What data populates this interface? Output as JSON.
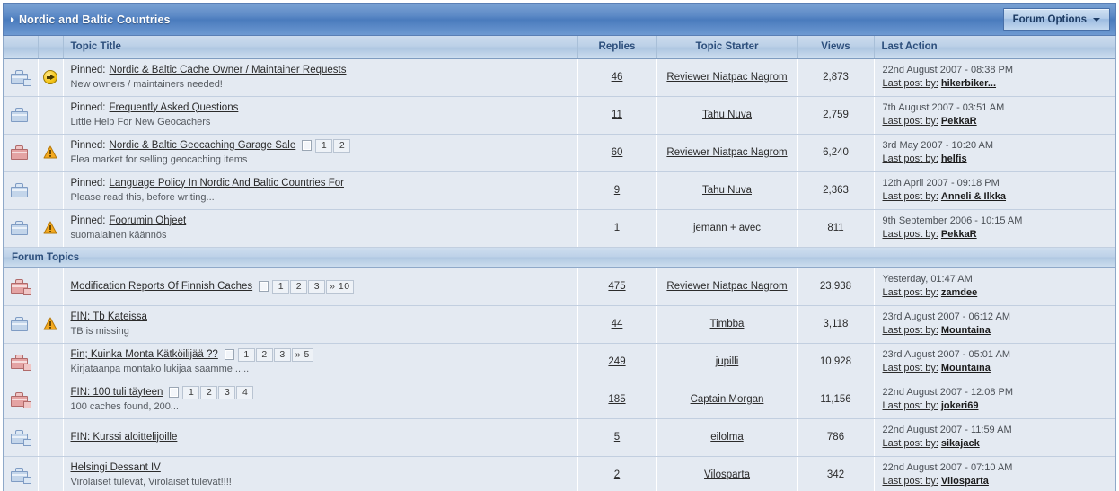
{
  "header": {
    "title": "Nordic and Baltic Countries",
    "expand_icon": "triangle-right-icon",
    "options_button": "Forum Options",
    "options_caret": "chevron-down-icon",
    "accent_blue": "#4a7bbd",
    "header_text": "#ffffff"
  },
  "columns": {
    "icon": "",
    "flag": "",
    "title": "Topic Title",
    "replies": "Replies",
    "starter": "Topic Starter",
    "views": "Views",
    "last_action": "Last Action"
  },
  "labels": {
    "pinned_prefix": "Pinned:",
    "last_post_by": "Last post by:",
    "section_forum_topics": "Forum Topics"
  },
  "pinned_rows": [
    {
      "folder": "blue-new",
      "status": "moved-icon",
      "pinned": true,
      "title": "Nordic & Baltic Cache Owner / Maintainer Requests",
      "desc": "New owners / maintainers needed!",
      "pages": [],
      "replies": "46",
      "starter": "Reviewer Niatpac Nagrom",
      "views": "2,873",
      "last_date": "22nd August 2007 - 08:38 PM",
      "last_user": "hikerbiker..."
    },
    {
      "folder": "blue",
      "status": "",
      "pinned": true,
      "title": "Frequently Asked Questions",
      "desc": "Little Help For New Geocachers",
      "pages": [],
      "replies": "11",
      "starter": "Tahu Nuva",
      "views": "2,759",
      "last_date": "7th August 2007 - 03:51 AM",
      "last_user": "PekkaR"
    },
    {
      "folder": "red",
      "status": "warning-icon",
      "pinned": true,
      "title": "Nordic & Baltic Geocaching Garage Sale",
      "desc": "Flea market for selling geocaching items",
      "pages": [
        "1",
        "2"
      ],
      "replies": "60",
      "starter": "Reviewer Niatpac Nagrom",
      "views": "6,240",
      "last_date": "3rd May 2007 - 10:20 AM",
      "last_user": "helfis"
    },
    {
      "folder": "blue",
      "status": "",
      "pinned": true,
      "title": "Language Policy In Nordic And Baltic Countries For",
      "desc": "Please read this, before writing...",
      "pages": [],
      "replies": "9",
      "starter": "Tahu Nuva",
      "views": "2,363",
      "last_date": "12th April 2007 - 09:18 PM",
      "last_user": "Anneli & Ilkka"
    },
    {
      "folder": "blue",
      "status": "warning-icon",
      "pinned": true,
      "title": "Foorumin Ohjeet",
      "desc": "suomalainen käännös",
      "pages": [],
      "replies": "1",
      "starter": "jemann + avec",
      "views": "811",
      "last_date": "9th September 2006 - 10:15 AM",
      "last_user": "PekkaR"
    }
  ],
  "topic_rows": [
    {
      "folder": "red-new",
      "status": "",
      "pinned": false,
      "title": "Modification Reports Of Finnish Caches",
      "desc": "",
      "pages": [
        "1",
        "2",
        "3",
        "» 10"
      ],
      "replies": "475",
      "starter": "Reviewer Niatpac Nagrom",
      "views": "23,938",
      "last_date": "Yesterday, 01:47 AM",
      "last_user": "zamdee"
    },
    {
      "folder": "blue",
      "status": "warning-icon",
      "pinned": false,
      "title": "FIN: Tb Kateissa",
      "desc": "TB is missing",
      "pages": [],
      "replies": "44",
      "starter": "Timbba",
      "views": "3,118",
      "last_date": "23rd August 2007 - 06:12 AM",
      "last_user": "Mountaina"
    },
    {
      "folder": "red-new",
      "status": "",
      "pinned": false,
      "title": "Fin; Kuinka Monta Kätköilijää ??",
      "desc": "Kirjataanpa montako lukijaa saamme .....",
      "pages": [
        "1",
        "2",
        "3",
        "» 5"
      ],
      "replies": "249",
      "starter": "jupilli",
      "views": "10,928",
      "last_date": "23rd August 2007 - 05:01 AM",
      "last_user": "Mountaina"
    },
    {
      "folder": "red-new",
      "status": "",
      "pinned": false,
      "title": "FIN: 100 tuli täyteen",
      "desc": "100 caches found, 200...",
      "pages": [
        "1",
        "2",
        "3",
        "4"
      ],
      "replies": "185",
      "starter": "Captain Morgan",
      "views": "11,156",
      "last_date": "22nd August 2007 - 12:08 PM",
      "last_user": "jokeri69"
    },
    {
      "folder": "blue-new",
      "status": "",
      "pinned": false,
      "title": "FIN: Kurssi aloittelijoille",
      "desc": "",
      "pages": [],
      "replies": "5",
      "starter": "eilolma",
      "views": "786",
      "last_date": "22nd August 2007 - 11:59 AM",
      "last_user": "sikajack"
    },
    {
      "folder": "blue-new",
      "status": "",
      "pinned": false,
      "title": "Helsingi Dessant IV",
      "desc": "Virolaiset tulevat, Virolaiset tulevat!!!!",
      "pages": [],
      "replies": "2",
      "starter": "Vilosparta",
      "views": "342",
      "last_date": "22nd August 2007 - 07:10 AM",
      "last_user": "Vilosparta"
    }
  ]
}
